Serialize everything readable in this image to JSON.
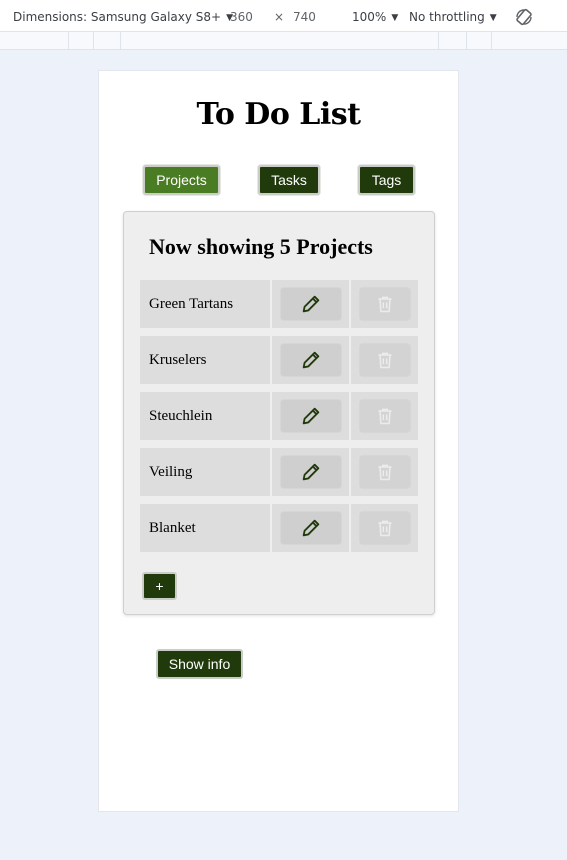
{
  "devtools": {
    "dimensions_label": "Dimensions: Samsung Galaxy S8+",
    "width_value": "360",
    "times_sign": "×",
    "height_value": "740",
    "zoom": "100%",
    "throttling": "No throttling",
    "rotate_icon": "rotate-icon"
  },
  "app": {
    "title": "To Do List",
    "nav": [
      {
        "label": "Projects",
        "active": true
      },
      {
        "label": "Tasks",
        "active": false
      },
      {
        "label": "Tags",
        "active": false
      }
    ],
    "panel": {
      "heading": "Now showing 5 Projects",
      "projects": [
        {
          "name": "Green Tartans"
        },
        {
          "name": "Kruselers"
        },
        {
          "name": "Steuchlein"
        },
        {
          "name": "Veiling"
        },
        {
          "name": "Blanket"
        }
      ],
      "edit_icon": "pencil-icon",
      "delete_icon": "trash-icon",
      "add_label": "+"
    },
    "show_info_label": "Show info"
  },
  "colors": {
    "button_dark": "#213a0c",
    "button_active": "#4a7c23",
    "edit_icon": "#213a0c",
    "delete_icon_disabled": "#ececec"
  }
}
